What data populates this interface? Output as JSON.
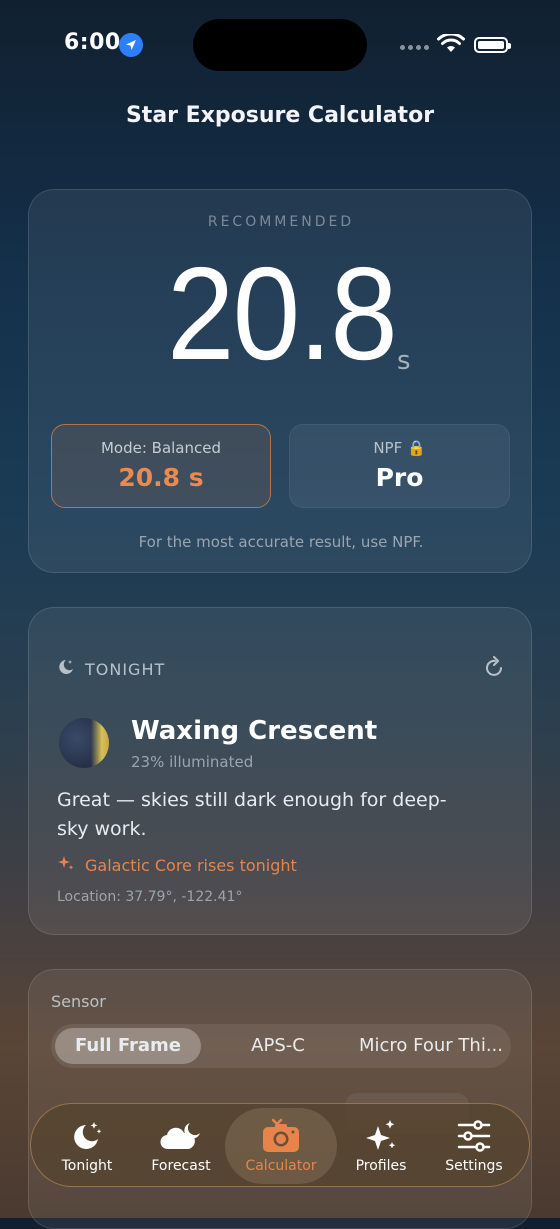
{
  "status_bar": {
    "time": "6:00"
  },
  "header": {
    "title": "Star Exposure Calculator"
  },
  "recommended": {
    "label": "RECOMMENDED",
    "value": "20.8",
    "unit": "s",
    "mode_label": "Mode: Balanced",
    "mode_value": "20.8 s",
    "npf_label": "NPF 🔒",
    "npf_value": "Pro",
    "hint": "For the most accurate result, use NPF."
  },
  "tonight": {
    "heading": "TONIGHT",
    "phase_name": "Waxing Crescent",
    "illumination": "23% illuminated",
    "verdict": "Great — skies still dark enough for deep-sky work.",
    "galactic_core": "Galactic Core rises tonight",
    "location": "Location: 37.79°, -122.41°"
  },
  "sensor": {
    "label": "Sensor",
    "options": [
      "Full Frame",
      "APS-C",
      "Micro Four Thi..."
    ],
    "selected": "Full Frame"
  },
  "tab_bar": {
    "items": [
      {
        "label": "Tonight",
        "icon": "moon-stars-icon"
      },
      {
        "label": "Forecast",
        "icon": "cloud-moon-icon"
      },
      {
        "label": "Calculator",
        "icon": "camera-icon"
      },
      {
        "label": "Profiles",
        "icon": "sparkles-icon"
      },
      {
        "label": "Settings",
        "icon": "sliders-icon"
      }
    ],
    "active": "Calculator"
  },
  "colors": {
    "accent": "#e8844b",
    "card_border": "#b4744a"
  }
}
